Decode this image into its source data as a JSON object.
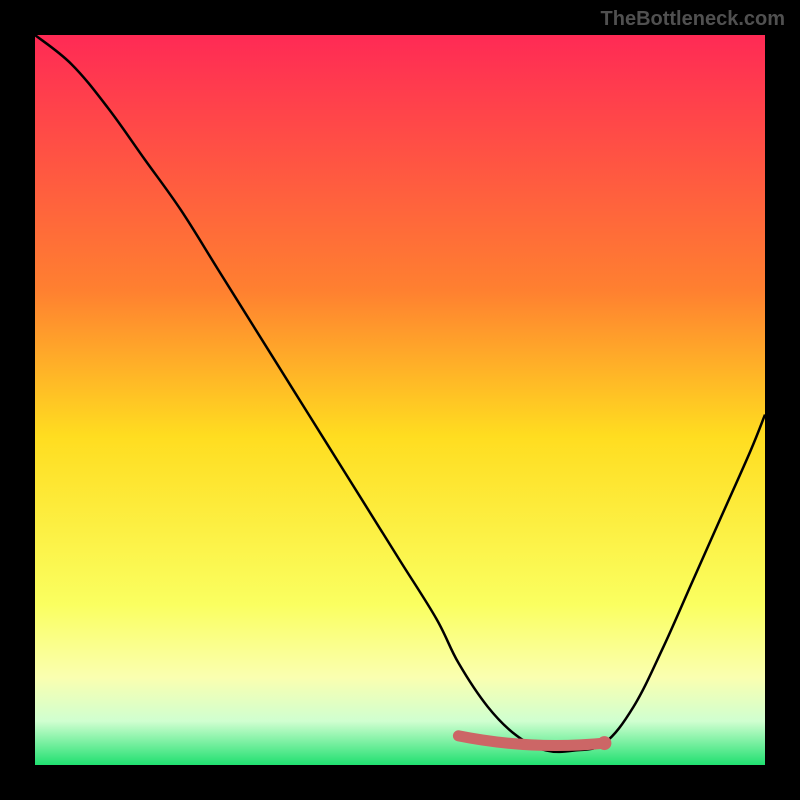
{
  "watermark": "TheBottleneck.com",
  "chart_data": {
    "type": "line",
    "title": "",
    "xlabel": "",
    "ylabel": "",
    "xlim": [
      0,
      100
    ],
    "ylim": [
      0,
      100
    ],
    "gradient_stops": [
      {
        "offset": 0,
        "color": "#ff2a55"
      },
      {
        "offset": 35,
        "color": "#ff8030"
      },
      {
        "offset": 55,
        "color": "#ffdd20"
      },
      {
        "offset": 78,
        "color": "#faff60"
      },
      {
        "offset": 88,
        "color": "#faffb0"
      },
      {
        "offset": 94,
        "color": "#d0ffd0"
      },
      {
        "offset": 100,
        "color": "#20e070"
      }
    ],
    "curve": {
      "description": "V-shaped bottleneck curve with minimum near x=70",
      "x": [
        0,
        5,
        10,
        15,
        20,
        25,
        30,
        35,
        40,
        45,
        50,
        55,
        58,
        62,
        66,
        70,
        74,
        78,
        82,
        86,
        90,
        94,
        98,
        100
      ],
      "y": [
        100,
        96,
        90,
        83,
        76,
        68,
        60,
        52,
        44,
        36,
        28,
        20,
        14,
        8,
        4,
        2,
        2,
        3,
        8,
        16,
        25,
        34,
        43,
        48
      ]
    },
    "highlight_region": {
      "color": "#cc6666",
      "x_start": 58,
      "x_end": 78,
      "y": 2
    },
    "highlight_dot": {
      "x": 78,
      "y": 3,
      "color": "#cc6666"
    }
  }
}
